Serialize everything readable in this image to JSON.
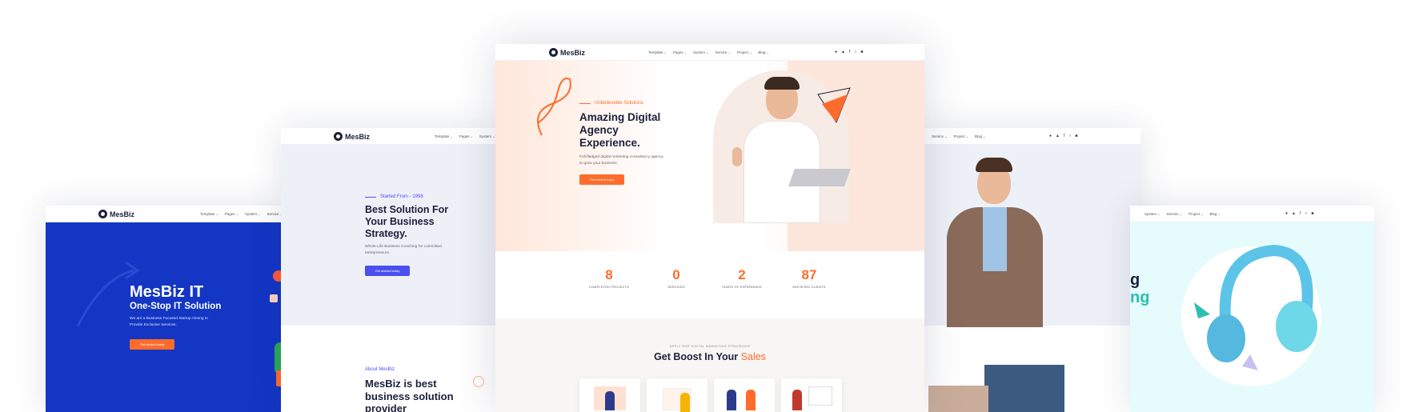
{
  "brand": "MesBiz",
  "nav_full": [
    "Template",
    "Pages",
    "System",
    "Service",
    "Project",
    "Blog"
  ],
  "nav_left": [
    "Template",
    "Pages",
    "System",
    "Service"
  ],
  "nav_right": [
    "Service",
    "Project",
    "Blog"
  ],
  "nav_far_right": [
    "System",
    "Service",
    "Project",
    "Blog"
  ],
  "social_icons": [
    "globe-icon",
    "twitter-icon",
    "facebook-icon",
    "instagram-icon",
    "linkedin-icon"
  ],
  "colors": {
    "orange": "#ff6b2b",
    "navy": "#1b1f3b",
    "blue": "#1336c4",
    "indigo": "#4a4ff0",
    "teal": "#2bbfb0"
  },
  "card1": {
    "title": "MesBiz IT",
    "subtitle": "One-Stop IT Solution",
    "text": "We are a Business Focused Startup Aiming to Provide Exclusive Services.",
    "cta": "Get started today"
  },
  "card2": {
    "eyebrow": "Started From - 1998",
    "title": "Best Solution For Your Business Strategy.",
    "text": "Whole-Life Business Coaching for committed entrepreneurs",
    "cta": "Get started today",
    "about_eyebrow": "About MesBiz",
    "about_title": "MesBiz is best business solution provider"
  },
  "center": {
    "eyebrow": "Unbelievable Solutions",
    "title": "Amazing Digital Agency Experience.",
    "text": "Full-fledged digital marketing consultancy agency to grow your business.",
    "cta": "Get started today",
    "stats": [
      {
        "num": "8",
        "label": "COMPLETED PROJECTS"
      },
      {
        "num": "0",
        "label": "SERVICES"
      },
      {
        "num": "2",
        "label": "YEARS OF EXPERIENCE"
      },
      {
        "num": "87",
        "label": "SATISFIED CLIENTS"
      }
    ],
    "boost_eyebrow": "APPLY OUR DIGITAL MARKETING STRATEGIES",
    "boost_title": "Get Boost In Your",
    "boost_highlight": "Sales"
  },
  "card5": {
    "title_fragment_1": "g",
    "title_fragment_2": "ng"
  }
}
